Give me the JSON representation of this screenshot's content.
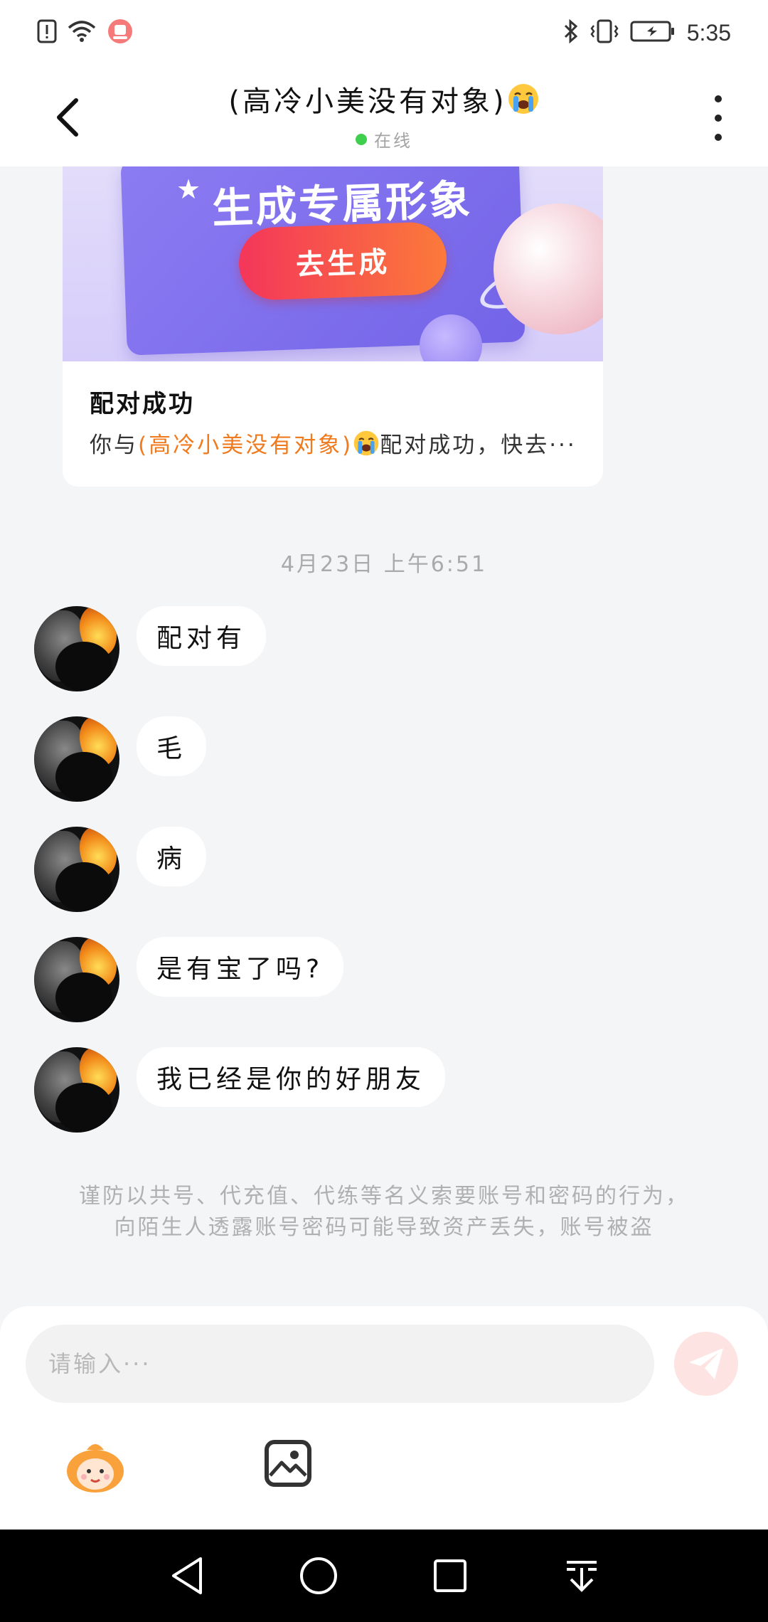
{
  "status_bar": {
    "time": "5:35",
    "icons": [
      "alert-icon",
      "wifi-icon",
      "app-notification-icon",
      "bluetooth-icon",
      "vibrate-icon",
      "battery-icon"
    ]
  },
  "header": {
    "title": "(高冷小美没有对象)",
    "title_emoji": "loudly-crying-emoji",
    "status": "在线",
    "status_color": "#3ecf4f"
  },
  "match_card": {
    "banner_text": "生成专属形象",
    "banner_button": "去生成",
    "title": "配对成功",
    "desc_prefix": "你与",
    "desc_highlight": "(高冷小美没有对象)",
    "desc_suffix": "配对成功，快去···",
    "highlight_color": "#f07a1e"
  },
  "timestamp": "4月23日 上午6:51",
  "messages": [
    {
      "text": "配对有"
    },
    {
      "text": "毛"
    },
    {
      "text": "病"
    },
    {
      "text": "是有宝了吗?"
    },
    {
      "text": "我已经是你的好朋友"
    }
  ],
  "notice": "谨防以共号、代充值、代练等名义索要账号和密码的行为，向陌生人透露账号密码可能导致资产丢失，账号被盗",
  "input": {
    "placeholder": "请输入···",
    "send_color": "#fde3e2"
  },
  "nav_bar": {
    "buttons": [
      "back-icon",
      "home-icon",
      "recents-icon",
      "download-icon"
    ]
  }
}
